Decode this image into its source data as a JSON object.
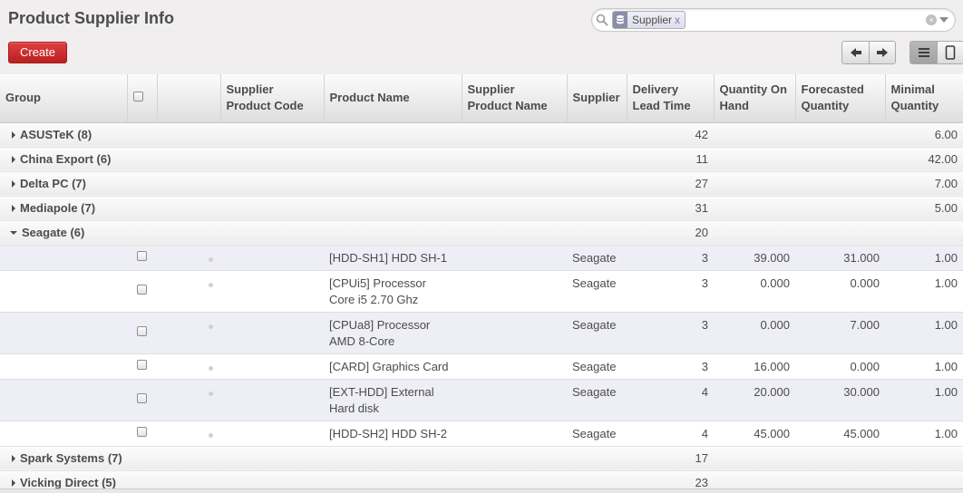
{
  "page": {
    "title": "Product Supplier Info"
  },
  "search": {
    "facet_label": "Supplier",
    "facet_close": "x",
    "clear_symbol": "×",
    "icons": [
      "search-icon",
      "database-icon",
      "clear-icon",
      "dropdown-icon"
    ]
  },
  "toolbar": {
    "create_label": "Create",
    "pager_icons": [
      "arrow-left-icon",
      "arrow-right-icon"
    ],
    "view_icons": [
      "list-view-icon",
      "form-view-icon"
    ]
  },
  "columns": {
    "group": "Group",
    "supplier_product_code": "Supplier Product Code",
    "product_name": "Product Name",
    "supplier_product_name": "Supplier Product Name",
    "supplier": "Supplier",
    "delivery_lead_time": "Delivery Lead Time",
    "quantity_on_hand": "Quantity On Hand",
    "forecasted_quantity": "Forecasted Quantity",
    "minimal_quantity": "Minimal Quantity"
  },
  "groups_top": [
    {
      "label": "ASUSTeK (8)",
      "lead": "42",
      "min": "6.00"
    },
    {
      "label": "China Export (6)",
      "lead": "11",
      "min": "42.00"
    },
    {
      "label": "Delta PC (7)",
      "lead": "27",
      "min": "7.00"
    },
    {
      "label": "Mediapole (7)",
      "lead": "31",
      "min": "5.00"
    },
    {
      "label": "Seagate (6)",
      "lead": "20",
      "min": ""
    }
  ],
  "records": [
    {
      "product_line1": "[HDD-SH1] HDD SH-1",
      "product_line2": "",
      "supplier": "Seagate",
      "lead": "3",
      "on_hand": "39.000",
      "forecast": "31.000",
      "min": "1.00"
    },
    {
      "product_line1": "[CPUi5] Processor",
      "product_line2": "Core i5 2.70 Ghz",
      "supplier": "Seagate",
      "lead": "3",
      "on_hand": "0.000",
      "forecast": "0.000",
      "min": "1.00"
    },
    {
      "product_line1": "[CPUa8] Processor",
      "product_line2": "AMD 8-Core",
      "supplier": "Seagate",
      "lead": "3",
      "on_hand": "0.000",
      "forecast": "7.000",
      "min": "1.00"
    },
    {
      "product_line1": "[CARD] Graphics Card",
      "product_line2": "",
      "supplier": "Seagate",
      "lead": "3",
      "on_hand": "16.000",
      "forecast": "0.000",
      "min": "1.00"
    },
    {
      "product_line1": "[EXT-HDD] External",
      "product_line2": "Hard disk",
      "supplier": "Seagate",
      "lead": "4",
      "on_hand": "20.000",
      "forecast": "30.000",
      "min": "1.00"
    },
    {
      "product_line1": "[HDD-SH2] HDD SH-2",
      "product_line2": "",
      "supplier": "Seagate",
      "lead": "4",
      "on_hand": "45.000",
      "forecast": "45.000",
      "min": "1.00"
    }
  ],
  "groups_bottom": [
    {
      "label": "Spark Systems (7)",
      "lead": "17",
      "min": ""
    },
    {
      "label": "Vicking Direct (5)",
      "lead": "23",
      "min": ""
    }
  ]
}
